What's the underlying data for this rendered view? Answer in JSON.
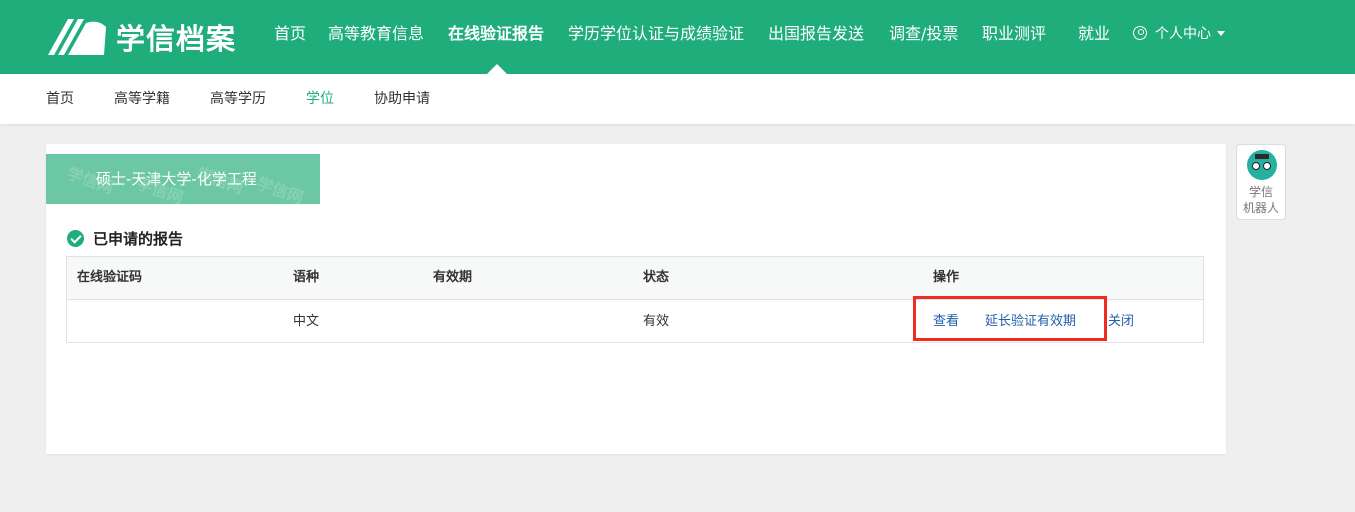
{
  "header": {
    "logo_text": "学信档案",
    "nav": [
      {
        "label": "首页"
      },
      {
        "label": "高等教育信息"
      },
      {
        "label": "在线验证报告"
      },
      {
        "label": "学历学位认证与成绩验证"
      },
      {
        "label": "出国报告发送"
      },
      {
        "label": "调查/投票"
      },
      {
        "label": "职业测评"
      },
      {
        "label": "就业"
      }
    ],
    "active_nav": "在线验证报告",
    "user_menu": "个人中心"
  },
  "subnav": {
    "items": [
      {
        "label": "首页"
      },
      {
        "label": "高等学籍"
      },
      {
        "label": "高等学历"
      },
      {
        "label": "学位"
      },
      {
        "label": "协助申请"
      }
    ],
    "active": "学位"
  },
  "degree_tab": {
    "label": "硕士-天津大学-化学工程",
    "watermark": "学信网"
  },
  "section": {
    "title": "已申请的报告"
  },
  "table": {
    "headers": [
      "在线验证码",
      "语种",
      "有效期",
      "状态",
      "操作"
    ],
    "rows": [
      {
        "code": "",
        "language": "中文",
        "validity": "",
        "status": "有效",
        "actions": [
          "查看",
          "延长验证有效期",
          "关闭"
        ]
      }
    ]
  },
  "robot": {
    "label_line1": "学信",
    "label_line2": "机器人"
  },
  "colors": {
    "brand_green": "#20ad7c",
    "tab_green": "#6cc7a5",
    "link_blue": "#1f5fa8",
    "highlight_red": "#f02b20"
  }
}
